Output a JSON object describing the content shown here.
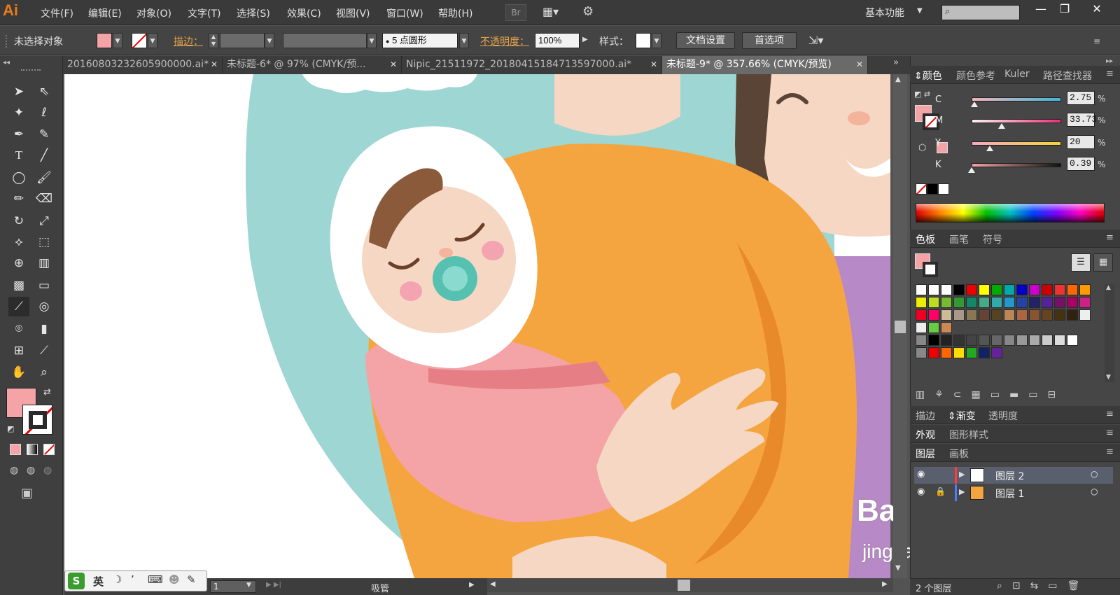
{
  "app": {
    "logo": "Ai",
    "menu": [
      "文件(F)",
      "编辑(E)",
      "对象(O)",
      "文字(T)",
      "选择(S)",
      "效果(C)",
      "视图(V)",
      "窗口(W)",
      "帮助(H)"
    ],
    "bridge_label": "Br",
    "workspace_label": "基本功能",
    "window_buttons": [
      "—",
      "❐",
      "✕"
    ]
  },
  "controlbar": {
    "selection_label": "未选择对象",
    "stroke_label": "描边：",
    "brush_label": "5 点圆形",
    "opacity_label": "不透明度：",
    "opacity_value": "100%",
    "style_label": "样式：",
    "doc_setup_button": "文档设置",
    "prefs_button": "首选项"
  },
  "tabs": [
    {
      "label": "20160803232605900000.ai*",
      "active": false
    },
    {
      "label": "未标题-6* @ 97% (CMYK/预...",
      "active": false
    },
    {
      "label": "Nipic_21511972_20180415184713597000.ai*",
      "active": false
    },
    {
      "label": "未标题-9* @ 357.66% (CMYK/预览)",
      "active": true
    }
  ],
  "color_panel": {
    "tabs": [
      "颜色",
      "颜色参考",
      "Kuler",
      "路径查找器"
    ],
    "channels": [
      {
        "label": "C",
        "value": "2.75",
        "level": 0.0275
      },
      {
        "label": "M",
        "value": "33.73",
        "level": 0.3373
      },
      {
        "label": "Y",
        "value": "20",
        "level": 0.2
      },
      {
        "label": "K",
        "value": "0.39",
        "level": 0.0039
      }
    ],
    "percent_sign": "%",
    "fill_color": "#f4a3a6"
  },
  "swatches_panel": {
    "tabs": [
      "色板",
      "画笔",
      "符号"
    ]
  },
  "lower_panels": {
    "row1_tabs": [
      "描边",
      "渐变",
      "透明度"
    ],
    "row2_tabs": [
      "外观",
      "图形样式"
    ],
    "row3_tabs": [
      "图层",
      "画板"
    ]
  },
  "layers": [
    {
      "name": "图层 2",
      "color": "#ff3b3b"
    },
    {
      "name": "图层 1",
      "color": "#4a7dff"
    }
  ],
  "layers_footer": "2 个图层",
  "status": {
    "zoom": "1",
    "tool": "吸管"
  },
  "ime": {
    "lang": "英"
  },
  "watermark": {
    "brand": "Bai",
    "brand_cn": "经验",
    "url": "jingyan.baidu.com"
  },
  "colors": {
    "accent": "#e87c1a",
    "teal": "#9dd6d3",
    "orange": "#f5a53f",
    "pink": "#f4a3a6"
  }
}
